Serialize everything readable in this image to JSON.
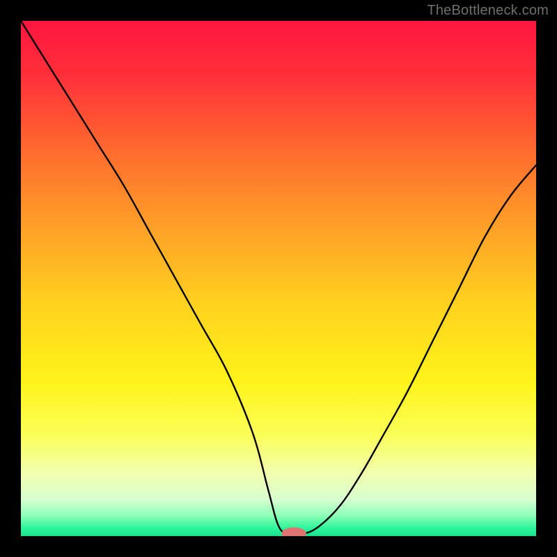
{
  "watermark": "TheBottleneck.com",
  "chart_data": {
    "type": "line",
    "title": "",
    "xlabel": "",
    "ylabel": "",
    "xlim": [
      0,
      100
    ],
    "ylim": [
      0,
      100
    ],
    "background_gradient_stops": [
      {
        "offset": 0.0,
        "color": "#ff163f"
      },
      {
        "offset": 0.1,
        "color": "#ff2e3a"
      },
      {
        "offset": 0.25,
        "color": "#ff6a2e"
      },
      {
        "offset": 0.4,
        "color": "#ffa028"
      },
      {
        "offset": 0.55,
        "color": "#ffd21e"
      },
      {
        "offset": 0.7,
        "color": "#fff31a"
      },
      {
        "offset": 0.8,
        "color": "#fbff55"
      },
      {
        "offset": 0.88,
        "color": "#f2ffb0"
      },
      {
        "offset": 0.93,
        "color": "#d6ffd0"
      },
      {
        "offset": 0.96,
        "color": "#8dffb8"
      },
      {
        "offset": 0.985,
        "color": "#2cf59a"
      },
      {
        "offset": 1.0,
        "color": "#1ae28a"
      }
    ],
    "curve": {
      "description": "V-shaped bottleneck curve",
      "x": [
        0,
        5,
        10,
        15,
        20,
        25,
        30,
        35,
        40,
        45,
        48,
        50,
        52,
        55,
        58,
        62,
        66,
        70,
        75,
        80,
        85,
        90,
        95,
        100
      ],
      "y": [
        100,
        92,
        84,
        76,
        68,
        59,
        50,
        41,
        32,
        20,
        9,
        2,
        0.5,
        0.5,
        2,
        6,
        12,
        19,
        28,
        38,
        48,
        58,
        66,
        72
      ]
    },
    "optimum_marker": {
      "x_center": 53,
      "y_center": 0.5,
      "rx": 2.4,
      "ry": 1.2,
      "color": "#e0736f"
    }
  }
}
